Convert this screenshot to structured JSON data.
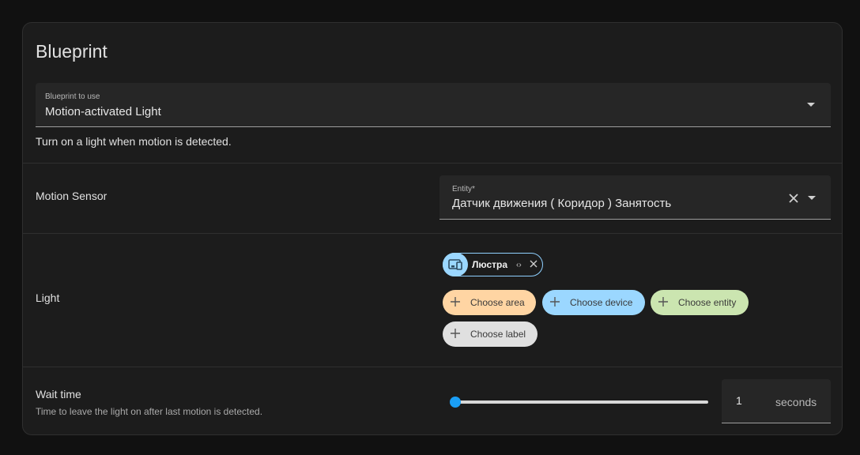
{
  "card": {
    "title": "Blueprint"
  },
  "blueprint_select": {
    "label": "Blueprint to use",
    "value": "Motion-activated Light"
  },
  "description": "Turn on a light when motion is detected.",
  "motion_sensor": {
    "label": "Motion Sensor",
    "field_label": "Entity*",
    "value": "Датчик движения ( Коридор ) Занятость"
  },
  "light": {
    "label": "Light",
    "selected_chip": "Люстра",
    "add_buttons": {
      "area": "Choose area",
      "device": "Choose device",
      "entity": "Choose entity",
      "label": "Choose label"
    }
  },
  "wait_time": {
    "label": "Wait time",
    "description": "Time to leave the light on after last motion is detected.",
    "value": "1",
    "slider_fraction": 0,
    "unit": "seconds"
  },
  "colors": {
    "accent": "#1a9ef5",
    "chip_device": "#9bd7ff",
    "chip_area": "#ffd5a3",
    "chip_entity": "#cbe5b0",
    "chip_label": "#e0e0e0"
  }
}
